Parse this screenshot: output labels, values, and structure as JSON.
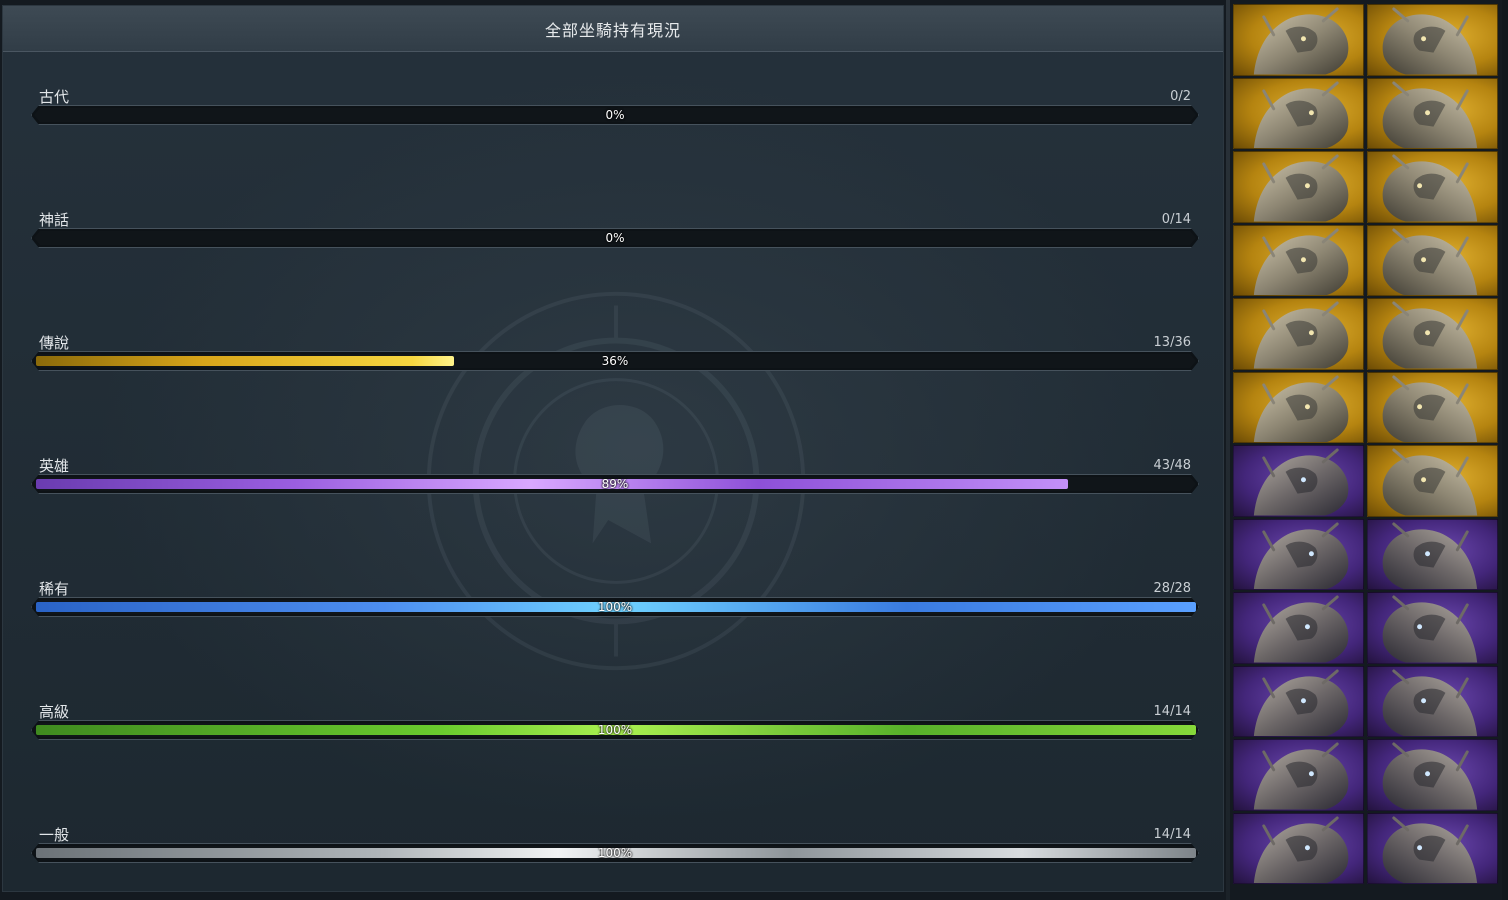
{
  "header": {
    "title": "全部坐騎持有現況"
  },
  "rows": [
    {
      "label": "古代",
      "count": "0/2",
      "percent_text": "0%",
      "fill": 0.0,
      "color": "#d8a51a"
    },
    {
      "label": "神話",
      "count": "0/14",
      "percent_text": "0%",
      "fill": 0.0,
      "color": "#e05a2a"
    },
    {
      "label": "傳說",
      "count": "13/36",
      "percent_text": "36%",
      "fill": 0.36,
      "color": "#f6d640"
    },
    {
      "label": "英雄",
      "count": "43/48",
      "percent_text": "89%",
      "fill": 0.89,
      "color": "#b070f0"
    },
    {
      "label": "稀有",
      "count": "28/28",
      "percent_text": "100%",
      "fill": 1.0,
      "color": "#4d8ef0"
    },
    {
      "label": "高級",
      "count": "14/14",
      "percent_text": "100%",
      "fill": 1.0,
      "color": "#6acb2e"
    },
    {
      "label": "一般",
      "count": "14/14",
      "percent_text": "100%",
      "fill": 1.0,
      "color": "#b0b6ba"
    }
  ],
  "mounts": [
    {
      "icon": "dragon-mount-icon",
      "rarity": "gold"
    },
    {
      "icon": "shadow-dragon-mount-icon",
      "rarity": "gold"
    },
    {
      "icon": "fire-dragon-mount-icon",
      "rarity": "gold"
    },
    {
      "icon": "white-beast-mount-icon",
      "rarity": "gold"
    },
    {
      "icon": "silver-wolf-mount-icon",
      "rarity": "gold"
    },
    {
      "icon": "stone-beast-mount-icon",
      "rarity": "gold"
    },
    {
      "icon": "armored-wolf-mount-icon",
      "rarity": "gold"
    },
    {
      "icon": "white-lion-mount-icon",
      "rarity": "gold"
    },
    {
      "icon": "chrome-horse-mount-icon",
      "rarity": "gold"
    },
    {
      "icon": "golden-beast-mount-icon",
      "rarity": "gold"
    },
    {
      "icon": "armored-horse-mount-icon",
      "rarity": "gold"
    },
    {
      "icon": "whale-mount-icon",
      "rarity": "gold"
    },
    {
      "icon": "armored-raptor-mount-icon",
      "rarity": "purple"
    },
    {
      "icon": "fish-beast-mount-icon",
      "rarity": "gold"
    },
    {
      "icon": "golden-horse-mount-icon",
      "rarity": "purple"
    },
    {
      "icon": "insect-beast-mount-icon",
      "rarity": "purple"
    },
    {
      "icon": "armored-bull-mount-icon",
      "rarity": "purple"
    },
    {
      "icon": "horned-beast-mount-icon",
      "rarity": "purple"
    },
    {
      "icon": "iron-bull-mount-icon",
      "rarity": "purple"
    },
    {
      "icon": "teal-raptor-mount-icon",
      "rarity": "purple"
    },
    {
      "icon": "pale-lion-mount-icon",
      "rarity": "purple"
    },
    {
      "icon": "horned-ram-mount-icon",
      "rarity": "purple"
    },
    {
      "icon": "grey-lizard-mount-icon",
      "rarity": "purple"
    },
    {
      "icon": "golden-bull-mount-icon",
      "rarity": "purple"
    }
  ]
}
